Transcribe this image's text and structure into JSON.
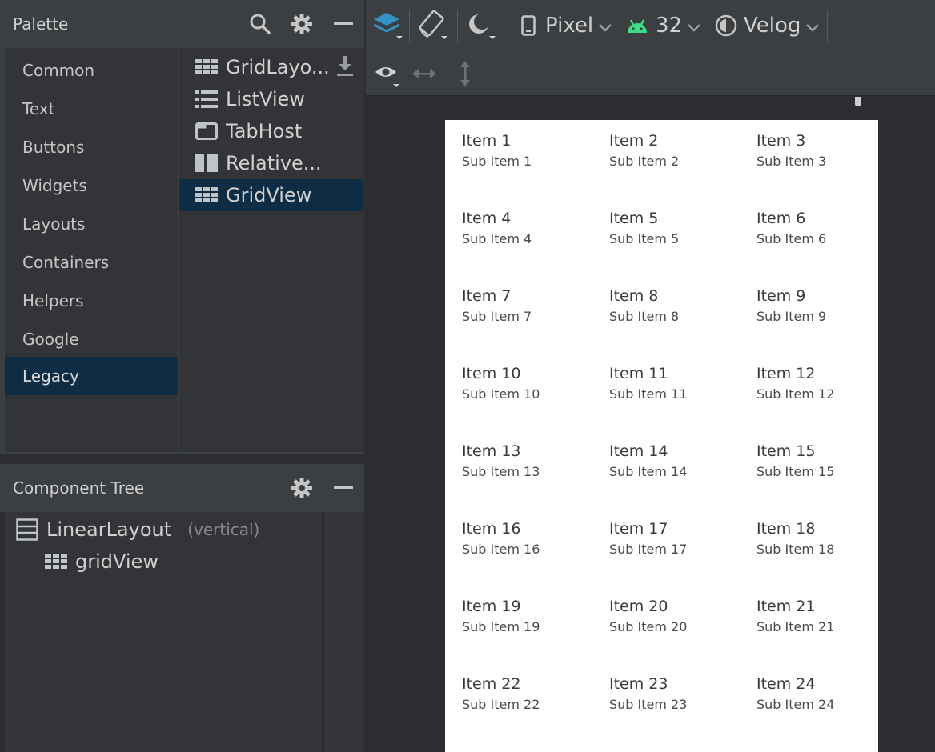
{
  "palette": {
    "title": "Palette",
    "categories": [
      "Common",
      "Text",
      "Buttons",
      "Widgets",
      "Layouts",
      "Containers",
      "Helpers",
      "Google",
      "Legacy"
    ],
    "selected_category": "Legacy",
    "items": [
      {
        "label": "GridLayo...",
        "icon": "grid-icon"
      },
      {
        "label": "ListView",
        "icon": "list-icon"
      },
      {
        "label": "TabHost",
        "icon": "tab-icon"
      },
      {
        "label": "Relative...",
        "icon": "relative-layout-icon"
      },
      {
        "label": "GridView",
        "icon": "grid-icon"
      }
    ],
    "selected_item": "GridView"
  },
  "component_tree": {
    "title": "Component Tree",
    "root": {
      "label": "LinearLayout",
      "sub": "(vertical)"
    },
    "child": {
      "label": "gridView"
    }
  },
  "toolbar": {
    "device": "Pixel",
    "api_level": "32",
    "theme": "Velog"
  },
  "grid": {
    "items": [
      {
        "title": "Item 1",
        "sub": "Sub Item 1"
      },
      {
        "title": "Item 2",
        "sub": "Sub Item 2"
      },
      {
        "title": "Item 3",
        "sub": "Sub Item 3"
      },
      {
        "title": "Item 4",
        "sub": "Sub Item 4"
      },
      {
        "title": "Item 5",
        "sub": "Sub Item 5"
      },
      {
        "title": "Item 6",
        "sub": "Sub Item 6"
      },
      {
        "title": "Item 7",
        "sub": "Sub Item 7"
      },
      {
        "title": "Item 8",
        "sub": "Sub Item 8"
      },
      {
        "title": "Item 9",
        "sub": "Sub Item 9"
      },
      {
        "title": "Item 10",
        "sub": "Sub Item 10"
      },
      {
        "title": "Item 11",
        "sub": "Sub Item 11"
      },
      {
        "title": "Item 12",
        "sub": "Sub Item 12"
      },
      {
        "title": "Item 13",
        "sub": "Sub Item 13"
      },
      {
        "title": "Item 14",
        "sub": "Sub Item 14"
      },
      {
        "title": "Item 15",
        "sub": "Sub Item 15"
      },
      {
        "title": "Item 16",
        "sub": "Sub Item 16"
      },
      {
        "title": "Item 17",
        "sub": "Sub Item 17"
      },
      {
        "title": "Item 18",
        "sub": "Sub Item 18"
      },
      {
        "title": "Item 19",
        "sub": "Sub Item 19"
      },
      {
        "title": "Item 20",
        "sub": "Sub Item 20"
      },
      {
        "title": "Item 21",
        "sub": "Sub Item 21"
      },
      {
        "title": "Item 22",
        "sub": "Sub Item 22"
      },
      {
        "title": "Item 23",
        "sub": "Sub Item 23"
      },
      {
        "title": "Item 24",
        "sub": "Sub Item 24"
      }
    ]
  },
  "colors": {
    "selection": "#0e2d45",
    "android_green": "#3ddc84",
    "accent_blue": "#3592c4"
  }
}
